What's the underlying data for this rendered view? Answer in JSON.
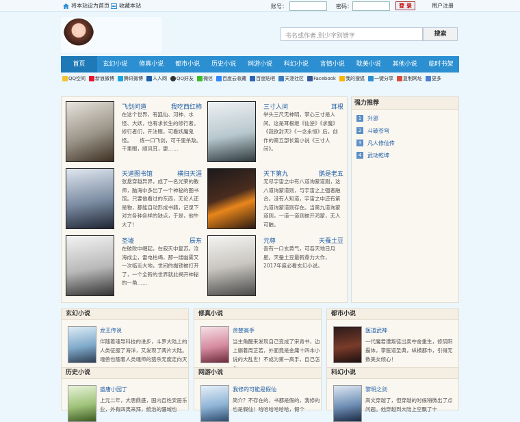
{
  "topbar": {
    "set_home": "将本站设为首页",
    "bookmark": "收藏本站",
    "account_label": "账号：",
    "password_label": "密码：",
    "login": "登 录",
    "register": "用户注册"
  },
  "search": {
    "placeholder": "书名或作者,别少字别错字",
    "button": "搜索"
  },
  "nav": [
    "首页",
    "玄幻小说",
    "修真小说",
    "都市小说",
    "历史小说",
    "网游小说",
    "科幻小说",
    "言情小说",
    "耽美小说",
    "其他小说",
    "临时书架"
  ],
  "share": [
    "QQ空间",
    "新浪微博",
    "腾讯微博",
    "人人网",
    "QQ好友",
    "微信",
    "百度云收藏",
    "百度贴吧",
    "天涯社区",
    "Facebook",
    "我的搜狐",
    "一键分享",
    "复制网址",
    "更多"
  ],
  "featured": [
    {
      "title": "飞剑问道",
      "author": "我吃西红柿",
      "desc": "在这个世界，有狐仙、河神、水怪、大妖，也有求长生的修行者。　　修行者们，开法眼，可看妖魔鬼怪。　　炼一口飞剑，可千里杀敌。　　千里眼，顺风耳，更……"
    },
    {
      "title": "三寸人间",
      "author": "耳根",
      "desc": "举头三尺无神明，掌心三寸是人间。这是耳根继《仙逆》《求魔》《我欲封天》《一念永恒》后，创作的第五部长篇小说《三寸人间》。"
    },
    {
      "title": "天道图书馆",
      "author": "横扫天涯",
      "desc": "张悬穿越异界，成了一名光荣的教师，脑海中多出了一个神秘的图书馆。只要他看过的东西，无论人还是物，都能自动形成书籍，记录下对方各种各样的缺点，于是，他牛大了！"
    },
    {
      "title": "天下第九",
      "author": "鹅是老五",
      "desc": "无尽宇宙之中有八道询蒙道则，这八道询蒙道则，与宇宙之上强者融合。没有人知道，宇宙之中还有第九道询蒙道则存在。当第九道询蒙道则，一道一道则被开鸿蒙，无人可触。"
    },
    {
      "title": "圣墟",
      "author": "辰东",
      "desc": "在破败中崛起，在寂灭中复苏。沧海成尘，雷电枯竭，那一缕幽雾又一次临近大地，世间的枷锁被打开了，一个全新的世界就此揭开神秘的一角……"
    },
    {
      "title": "元尊",
      "author": "天蚕土豆",
      "desc": "吾有一口玄黄气，可吞天地日月星。天蚕土豆最新鼎力大作，2017年度必看玄幻小说。"
    }
  ],
  "ranking": {
    "title": "强力推荐",
    "items": [
      "升邪",
      "斗破苍穹",
      "凡人修仙传",
      "武动乾坤"
    ]
  },
  "categories": [
    {
      "name": "玄幻小说",
      "book": "龙王传说",
      "desc": "伴随着魂导科技的进步，斗罗大陆上的人类征服了海洋，又发现了两片大陆。魂兽也随着人类魂师的猎杀无度走向灭"
    },
    {
      "name": "修真小说",
      "book": "贪婪高手",
      "desc": "当主角醒来发现自己变成了宋青书，边上躺着周芷若，外面竟是金庸十四本小说的大乱世！不成为第一高手，自己怎么"
    },
    {
      "name": "都市小说",
      "book": "医道武神",
      "desc": "一代魔君遭叛徒出卖夺舍重生，修阴阳霸体，掌医道圣典，纵横都市，引得无数美女倾心！"
    },
    {
      "name": "历史小说",
      "book": "盛唐小园丁",
      "desc": "上元二年，大唐鼎盛，国内百姓安居乐业，外有四夷来拜，统治的疆域也"
    },
    {
      "name": "网游小说",
      "book": "我修的可能是假仙",
      "desc": "简介？不存在的，书都是假的，我修的也是假仙！哈哈哈哈哈哈，假个"
    },
    {
      "name": "科幻小说",
      "book": "黎明之剑",
      "desc": "高文穿越了，但穿越的时候稍微出了点问题。他穿越到大陆上空飘了十"
    }
  ]
}
